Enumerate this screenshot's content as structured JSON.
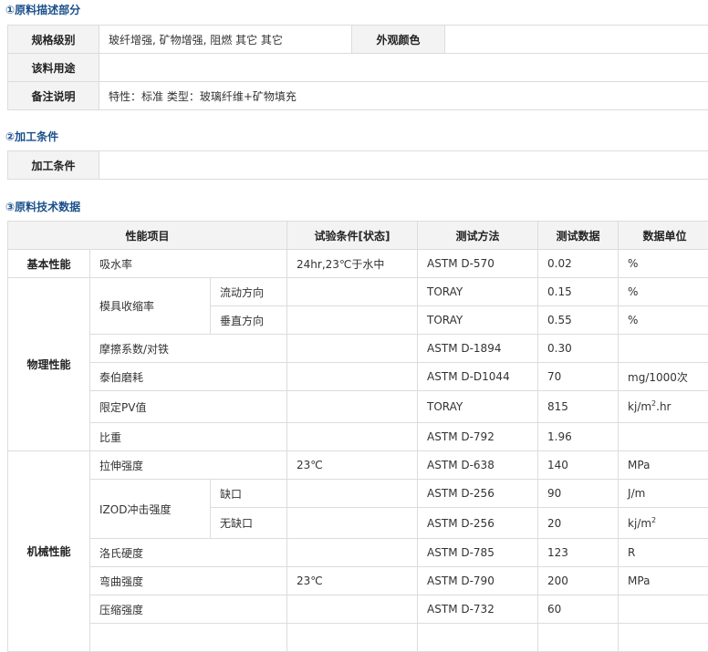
{
  "section1": {
    "title": "①原料描述部分",
    "spec_label": "规格级别",
    "spec_value": "玻纤增强, 矿物增强, 阻燃 其它 其它",
    "color_label": "外观颜色",
    "color_value": "",
    "usage_label": "该料用途",
    "usage_value": "",
    "remark_label": "备注说明",
    "remark_value": "特性：标准 类型：玻璃纤维+矿物填充"
  },
  "section2": {
    "title": "②加工条件",
    "label": "加工条件",
    "value": ""
  },
  "section3": {
    "title": "③原料技术数据",
    "headers": {
      "property": "性能项目",
      "condition": "试验条件[状态]",
      "method": "测试方法",
      "data": "测试数据",
      "unit": "数据单位"
    },
    "groups": {
      "basic": "基本性能",
      "physical": "物理性能",
      "mechanical": "机械性能"
    },
    "rows": {
      "water": {
        "name": "吸水率",
        "condition": "24hr,23℃于水中",
        "method": "ASTM D-570",
        "value": "0.02",
        "unit": "%"
      },
      "shrink": {
        "name": "模具收缩率"
      },
      "flow": {
        "sub": "流动方向",
        "method": "TORAY",
        "value": "0.15",
        "unit": "%"
      },
      "vertical": {
        "sub": "垂直方向",
        "method": "TORAY",
        "value": "0.55",
        "unit": "%"
      },
      "friction": {
        "name": "摩擦系数/对铁",
        "method": "ASTM D-1894",
        "value": "0.30",
        "unit": ""
      },
      "taber": {
        "name": "泰伯磨耗",
        "method": "ASTM D-D1044",
        "value": "70",
        "unit": "mg/1000次"
      },
      "pv": {
        "name": "限定PV值",
        "method": "TORAY",
        "value": "815",
        "unit_pre": "kj/m",
        "unit_sup": "2",
        "unit_post": ".hr"
      },
      "gravity": {
        "name": "比重",
        "method": "ASTM D-792",
        "value": "1.96",
        "unit": ""
      },
      "tensile": {
        "name": "拉伸强度",
        "condition": "23℃",
        "method": "ASTM D-638",
        "value": "140",
        "unit": "MPa"
      },
      "izod": {
        "name": "IZOD冲击强度"
      },
      "notched": {
        "sub": "缺口",
        "method": "ASTM D-256",
        "value": "90",
        "unit": "J/m"
      },
      "unnotched": {
        "sub": "无缺口",
        "method": "ASTM D-256",
        "value": "20",
        "unit_pre": "kj/m",
        "unit_sup": "2"
      },
      "rockwell": {
        "name": "洛氏硬度",
        "method": "ASTM D-785",
        "value": "123",
        "unit": "R"
      },
      "flexural": {
        "name": "弯曲强度",
        "condition": "23℃",
        "method": "ASTM D-790",
        "value": "200",
        "unit": "MPa"
      },
      "compress": {
        "name": "压缩强度",
        "method": "ASTM D-732",
        "value": "60",
        "unit": ""
      }
    }
  }
}
